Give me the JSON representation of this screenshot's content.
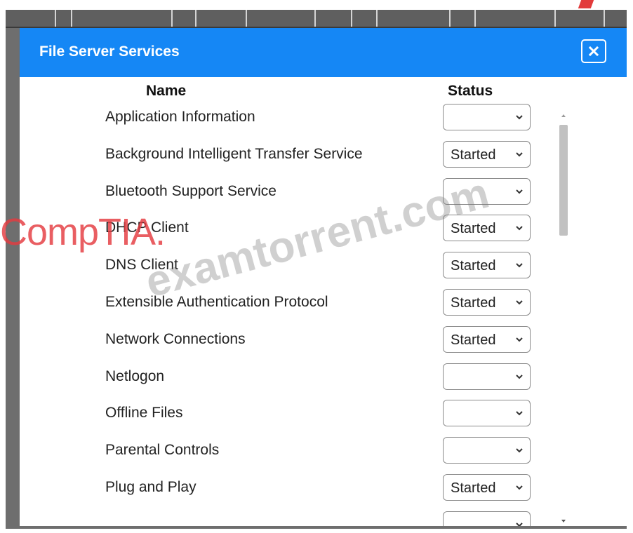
{
  "dialog": {
    "title": "File Server Services",
    "close_icon": "close-icon"
  },
  "table": {
    "headers": {
      "name": "Name",
      "status": "Status"
    },
    "rows": [
      {
        "name": "Application Information",
        "status": ""
      },
      {
        "name": "Background Intelligent Transfer Service",
        "status": "Started"
      },
      {
        "name": "Bluetooth Support Service",
        "status": ""
      },
      {
        "name": "DHCP Client",
        "status": "Started"
      },
      {
        "name": "DNS Client",
        "status": "Started"
      },
      {
        "name": "Extensible Authentication Protocol",
        "status": "Started"
      },
      {
        "name": "Network Connections",
        "status": "Started"
      },
      {
        "name": "Netlogon",
        "status": ""
      },
      {
        "name": "Offline Files",
        "status": ""
      },
      {
        "name": "Parental Controls",
        "status": ""
      },
      {
        "name": "Plug and Play",
        "status": "Started"
      },
      {
        "name": "",
        "status": ""
      }
    ]
  },
  "watermarks": {
    "brand": "CompTIA.",
    "site": "examtorrent.com"
  },
  "colors": {
    "titlebar": "#1587f5",
    "brand_watermark": "#e43a40"
  }
}
